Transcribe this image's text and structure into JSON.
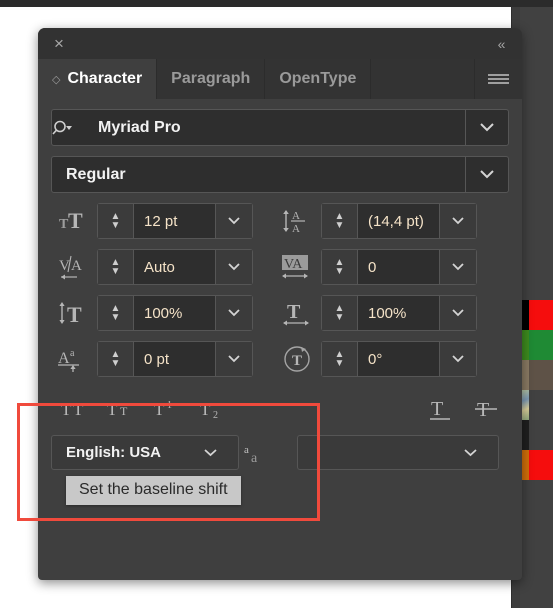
{
  "app": {
    "panel_title": "Character",
    "background_color": "#ffffff",
    "panel_bg": "#3f3f3f",
    "field_bg": "#2e2e2e",
    "value_color": "#f5e3c8",
    "accent_highlight": "#f04a3c"
  },
  "titlebar": {
    "close_label": "×",
    "collapse_label": "«"
  },
  "tabs": [
    {
      "label": "Character",
      "active": true
    },
    {
      "label": "Paragraph",
      "active": false
    },
    {
      "label": "OpenType",
      "active": false
    }
  ],
  "menu": {
    "icon": "hamburger-menu-icon"
  },
  "font": {
    "family_icon": "search-font-icon",
    "family_value": "Myriad Pro",
    "style_value": "Regular",
    "dropdown_arrow": "⌄"
  },
  "metrics": [
    {
      "left": {
        "icon": "font-size-icon",
        "name": "font-size",
        "value": "12 pt"
      },
      "right": {
        "icon": "leading-icon",
        "name": "leading",
        "value": "(14,4 pt)"
      }
    },
    {
      "left": {
        "icon": "kerning-icon",
        "name": "kerning",
        "value": "Auto"
      },
      "right": {
        "icon": "tracking-icon",
        "name": "tracking",
        "value": "0"
      }
    },
    {
      "left": {
        "icon": "vertical-scale-icon",
        "name": "vertical-scale",
        "value": "100%"
      },
      "right": {
        "icon": "horizontal-scale-icon",
        "name": "horizontal-scale",
        "value": "100%"
      }
    },
    {
      "left": {
        "icon": "baseline-shift-icon",
        "name": "baseline-shift",
        "value": "0 pt"
      },
      "right": {
        "icon": "character-rotation-icon",
        "name": "character-rotation",
        "value": "0°"
      }
    }
  ],
  "case_buttons": [
    {
      "name": "all-caps-button",
      "icon": "TT"
    },
    {
      "name": "small-caps-button",
      "icon": "Tt"
    },
    {
      "name": "superscript-button",
      "icon": "T1"
    },
    {
      "name": "subscript-button",
      "icon": "T2"
    },
    {
      "name": "underline-button",
      "icon": "underline-T-icon"
    },
    {
      "name": "strikethrough-button",
      "icon": "strikethrough-T-icon"
    }
  ],
  "language": {
    "value": "English: USA",
    "antialias_icon": "anti-aliasing-icon",
    "antialias_value": ""
  },
  "tooltip": {
    "text": "Set the baseline shift"
  },
  "swatches": [
    {
      "name": "swatch-red",
      "edge": "#000000",
      "main": "#f50d0d"
    },
    {
      "name": "swatch-green",
      "edge": "#3d8c1e",
      "main": "#1f8a34"
    },
    {
      "name": "swatch-brown",
      "edge": "#8a7a63",
      "main": "#5e5247"
    },
    {
      "name": "swatch-pattern",
      "edge": "#9db08f",
      "main": "#414141"
    },
    {
      "name": "swatch-dark",
      "edge": "#1f1f1f",
      "main": "#414141"
    },
    {
      "name": "swatch-orange-red",
      "edge": "#d2700a",
      "main": "#f50d0d"
    }
  ]
}
